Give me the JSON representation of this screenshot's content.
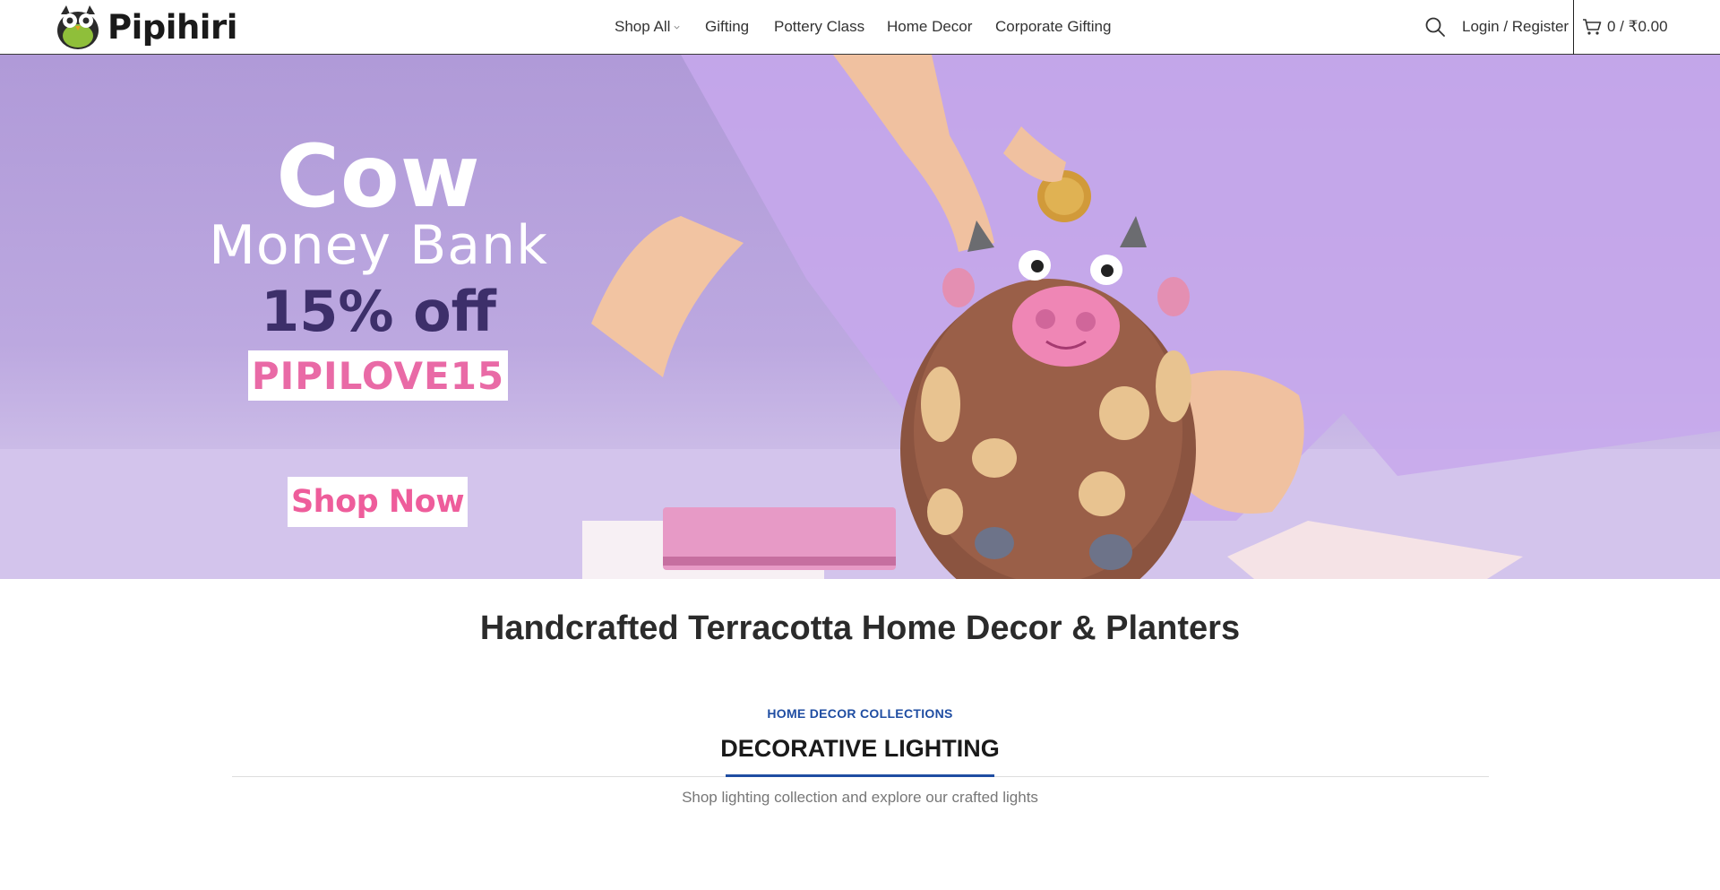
{
  "header": {
    "brand": "Pipihiri",
    "nav": [
      {
        "label": "Shop All"
      },
      {
        "label": "Gifting"
      },
      {
        "label": "Pottery Class"
      },
      {
        "label": "Home Decor"
      },
      {
        "label": "Corporate Gifting"
      }
    ],
    "login_label": "Login / Register",
    "cart_label": "0 / ₹0.00"
  },
  "hero": {
    "line1": "Cow",
    "line2": "Money Bank",
    "line3": "15% off",
    "coupon_code": "PIPILOVE15",
    "cta_label": "Shop Now",
    "colors": {
      "background": "#b09ad8",
      "discount_text": "#3d2f6a",
      "coupon_text": "#e96aa6",
      "cta_text": "#ee5d9b"
    }
  },
  "main": {
    "heading": "Handcrafted Terracotta Home Decor & Planters",
    "collection": {
      "subtitle": "HOME DECOR COLLECTIONS",
      "title": "DECORATIVE LIGHTING",
      "description": "Shop lighting collection and explore our crafted lights",
      "accent": "#1f4da2"
    }
  },
  "icons": [
    "owl-logo-icon",
    "chevron-down-icon",
    "search-icon",
    "cart-icon"
  ]
}
